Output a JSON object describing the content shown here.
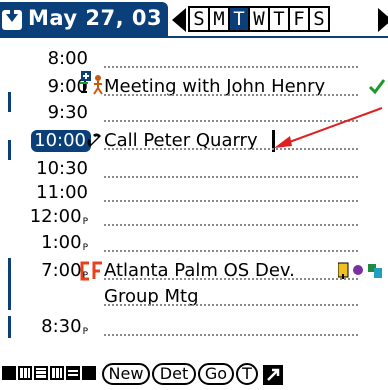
{
  "header": {
    "date_label": "May 27, 03",
    "days": [
      "S",
      "M",
      "T",
      "W",
      "T",
      "F",
      "S"
    ],
    "selected_day_index": 2
  },
  "times": {
    "t800": "8:00",
    "t900": "9:00",
    "t930": "9:30",
    "t1000": "10:00",
    "t1030": "10:30",
    "t1100": "11:00",
    "t1200": "12:00",
    "t100": "1:00",
    "t700": "7:00",
    "t830": "8:30",
    "pm_marker": "P"
  },
  "events": {
    "meeting": "Meeting with John Henry",
    "call": "Call Peter Quarry",
    "atlanta_line1": "Atlanta Palm OS Dev.",
    "atlanta_line2": "Group Mtg"
  },
  "buttons": {
    "new": "New",
    "details": "Det",
    "go": "Go",
    "today": "T"
  },
  "colors": {
    "brand": "#0a3f7a",
    "annotation_arrow": "#e02020",
    "check": "#1a9a2a"
  },
  "icons": {
    "meeting": "meeting-people-icon",
    "call": "phone-icon",
    "category": "cf-category-icon",
    "note": "note-icon",
    "done": "checkmark-icon"
  }
}
